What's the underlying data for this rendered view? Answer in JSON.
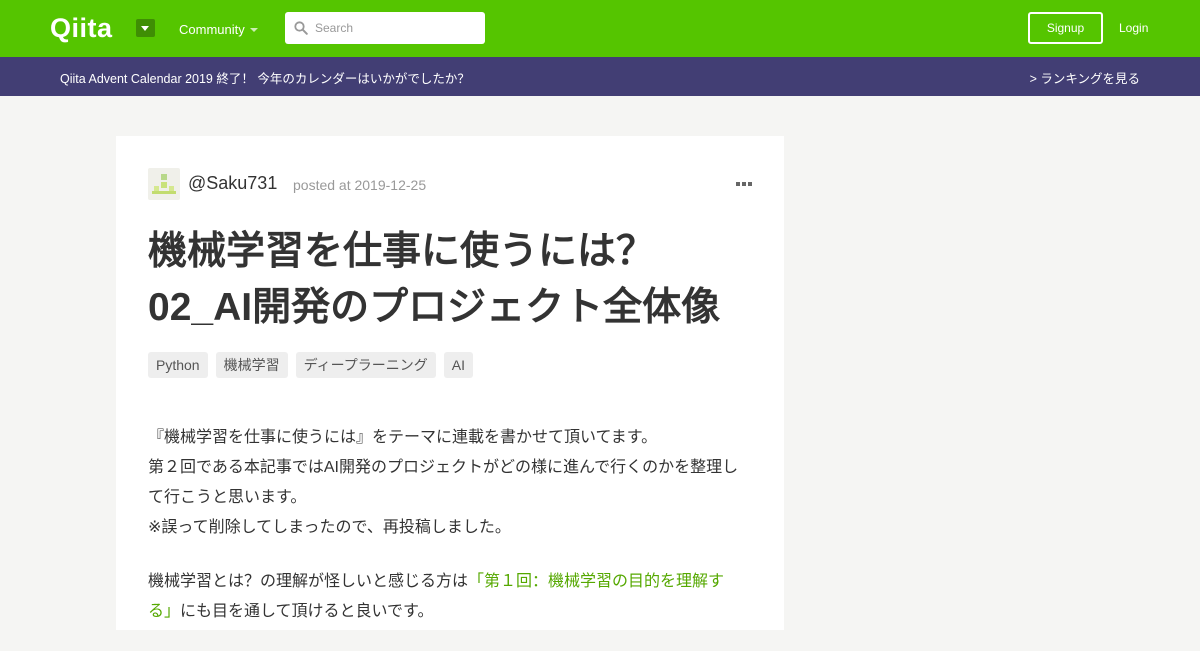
{
  "header": {
    "logo": "Qiita",
    "community_label": "Community",
    "search_placeholder": "Search",
    "signup_label": "Signup",
    "login_label": "Login"
  },
  "banner": {
    "text": "Qiita Advent Calendar 2019 終了！ 今年のカレンダーはいかがでしたか？",
    "link": "> ランキングを見る"
  },
  "article": {
    "username": "@Saku731",
    "posted": "posted at 2019-12-25",
    "title_line1": "機械学習を仕事に使うには？",
    "title_line2": "02_AI開発のプロジェクト全体像",
    "tags": [
      "Python",
      "機械学習",
      "ディープラーニング",
      "AI"
    ],
    "para1_line1": "『機械学習を仕事に使うには』をテーマに連載を書かせて頂いてます。",
    "para1_line2": "第２回である本記事ではAI開発のプロジェクトがどの様に進んで行くのかを整理し",
    "para1_line3": "て行こうと思います。",
    "para1_line4": "※誤って削除してしまったので、再投稿しました。",
    "para2_before": "機械学習とは？の理解が怪しいと感じる方は",
    "para2_link": "「第１回：機械学習の目的を理解する」",
    "para2_after": "にも目を通して頂けると良いです。"
  },
  "colors": {
    "header_bg": "#55c500",
    "banner_bg": "#423e74",
    "link": "#55a800"
  },
  "icons": {
    "logo_dropdown": "caret-down-icon",
    "search": "search-icon",
    "more": "more-horizontal-icon"
  }
}
